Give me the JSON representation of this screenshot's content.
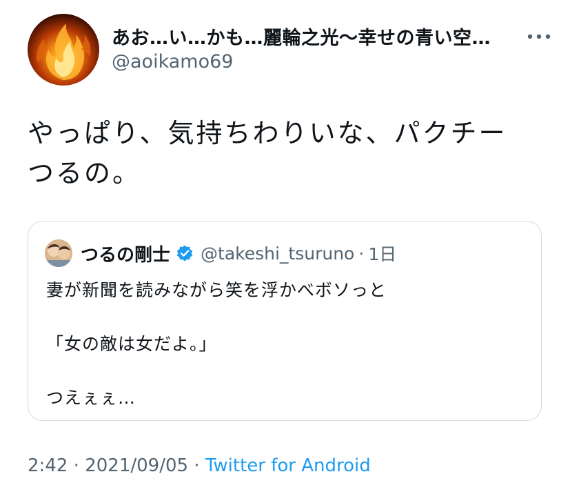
{
  "author": {
    "display_name": "あお…い…かも…麗輪之光〜幸せの青い空…",
    "handle": "@aoikamo69",
    "avatar_icon": "flame-avatar-icon"
  },
  "more_icon": "more-dots-icon",
  "tweet": {
    "text_lines": [
      "やっぱり、気持ちわりいな、パクチー",
      "つるの。"
    ]
  },
  "quote": {
    "name": "つるの剛士",
    "handle": "@takeshi_tsuruno",
    "separator": "·",
    "time": "1日",
    "verified_icon": "verified-badge-icon",
    "lines": [
      "妻が新聞を読みながら笑を浮かべボソっと",
      "「女の敵は女だよ。」",
      "つえぇぇ…"
    ]
  },
  "footer": {
    "time": "2:42",
    "sep1": "·",
    "date": "2021/09/05",
    "sep2": "·",
    "source": "Twitter for Android"
  },
  "colors": {
    "text": "#0f1419",
    "secondary": "#536471",
    "accent": "#1d9bf0",
    "border": "#cfd9de"
  }
}
